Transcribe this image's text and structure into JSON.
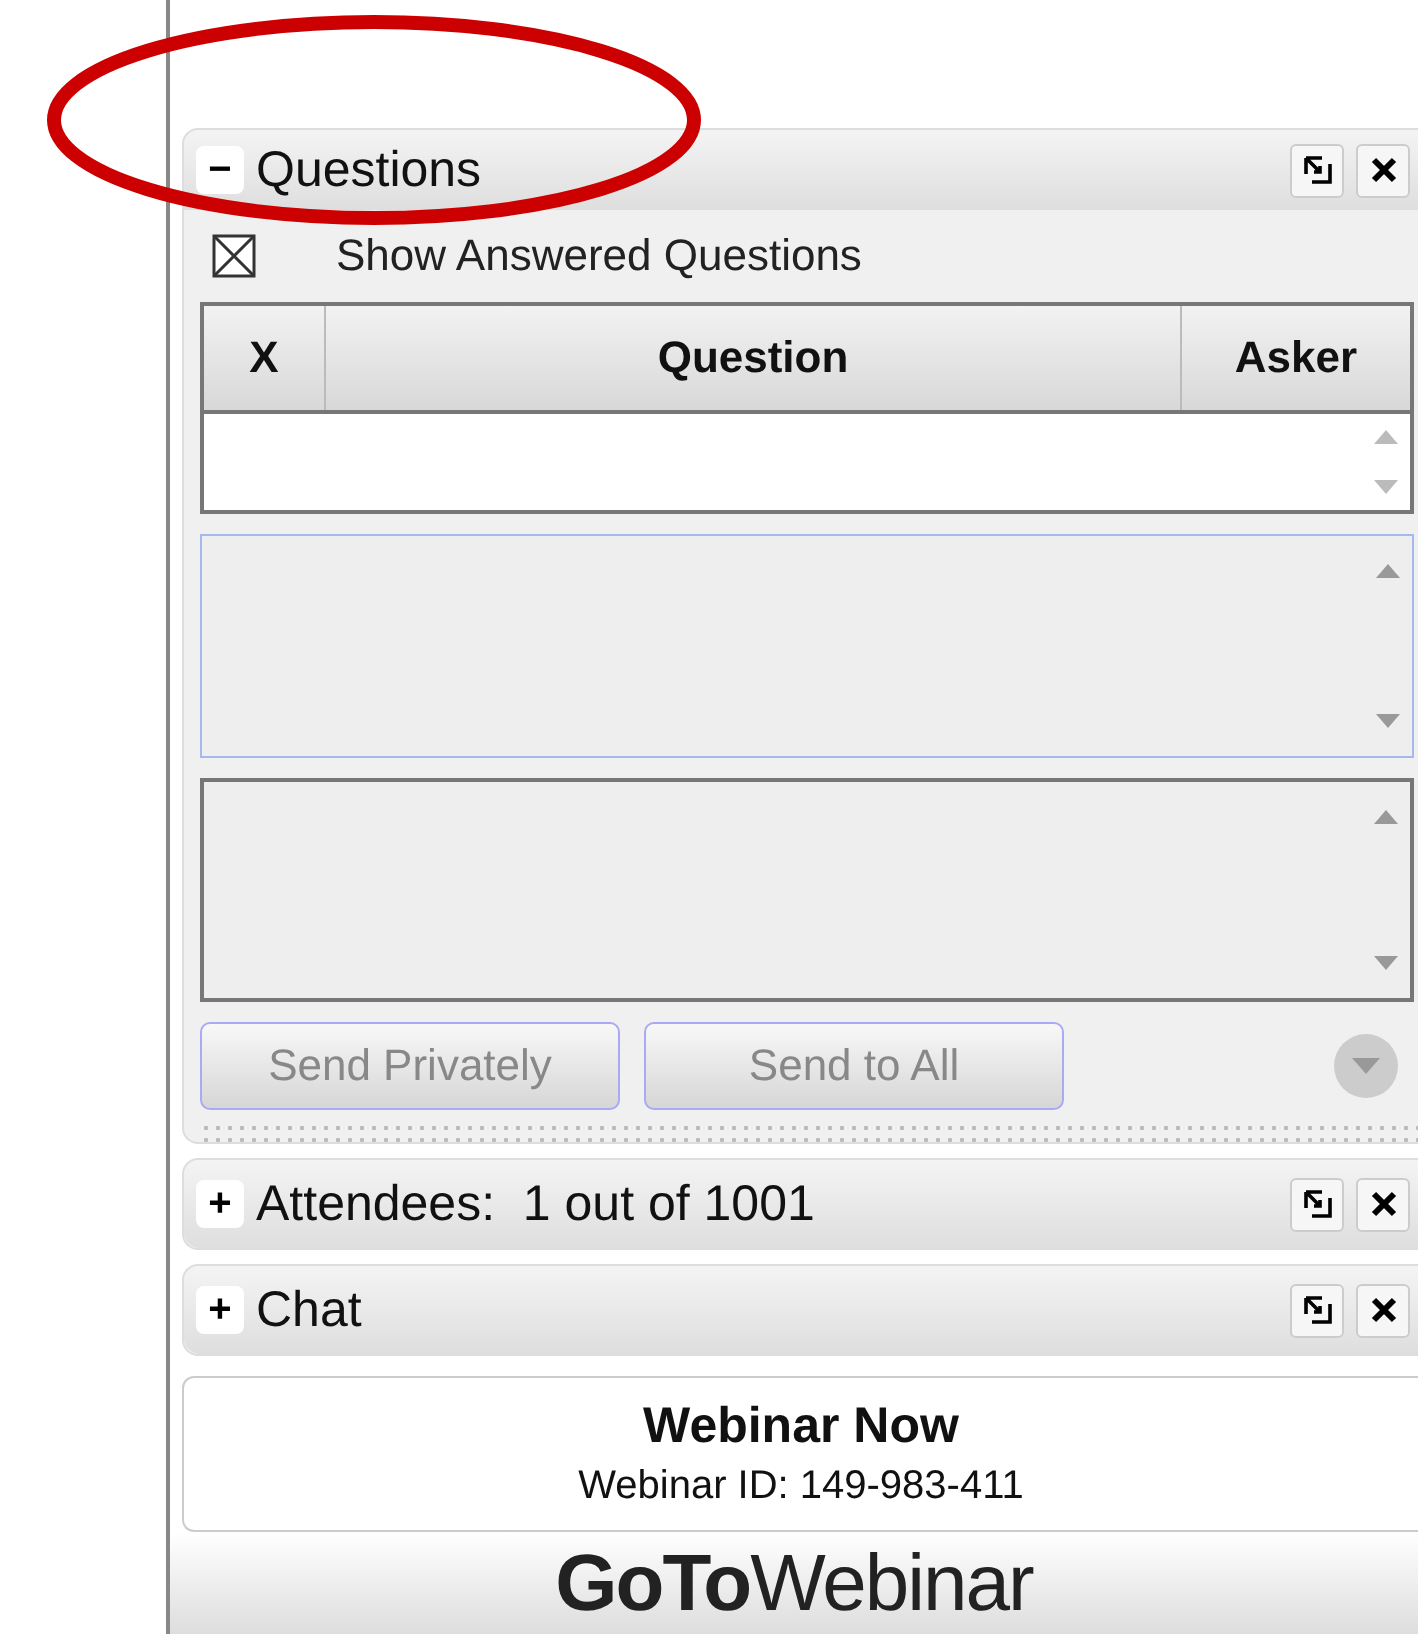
{
  "questions_panel": {
    "toggle": "−",
    "title": "Questions",
    "show_answered": {
      "label": "Show Answered Questions",
      "checked": true
    },
    "table": {
      "columns": [
        "X",
        "Question",
        "Asker"
      ]
    },
    "buttons": [
      {
        "label": "Send Privately",
        "disabled": true
      },
      {
        "label": "Send to All",
        "disabled": true
      }
    ]
  },
  "panels": [
    {
      "toggle": "+",
      "title": "Attendees:  1 out of 1001"
    },
    {
      "toggle": "+",
      "title": "Chat"
    }
  ],
  "info": {
    "title": "Webinar Now",
    "webinar_id": "Webinar ID: 149-983-411"
  },
  "logo": "**GoTo**Webinar"
}
